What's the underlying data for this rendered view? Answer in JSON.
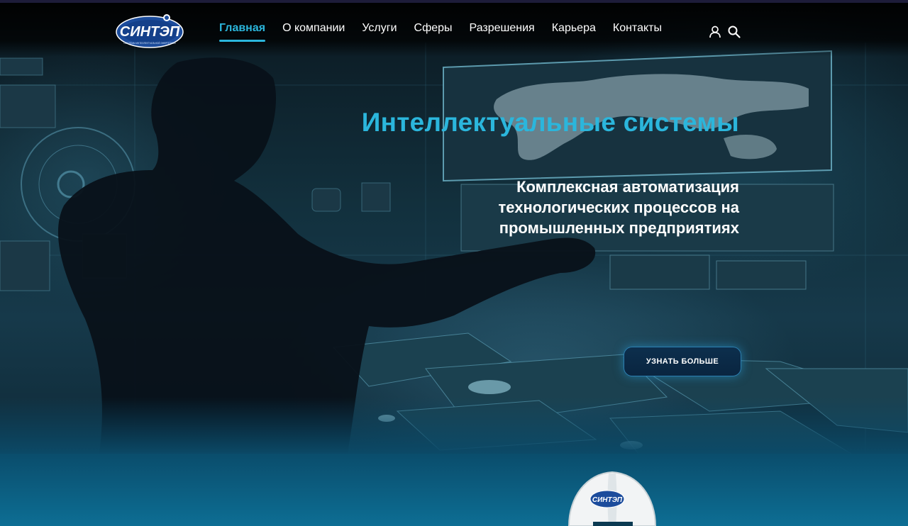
{
  "brand": {
    "logo_text": "СИНТЭП",
    "logo_tagline": "СИСТЕМЫ ИНТЕЛЛЕКТУАЛЬНОЙ ЭНЕРГЕТИКИ"
  },
  "nav": {
    "items": [
      {
        "label": "Главная",
        "active": true
      },
      {
        "label": "О компании",
        "active": false
      },
      {
        "label": "Услуги",
        "active": false
      },
      {
        "label": "Сферы",
        "active": false
      },
      {
        "label": "Разрешения",
        "active": false
      },
      {
        "label": "Карьера",
        "active": false
      },
      {
        "label": "Контакты",
        "active": false
      }
    ],
    "icons": [
      "user-icon",
      "search-icon"
    ]
  },
  "hero": {
    "title": "Интеллектуальные системы",
    "subtitle": "Комплексная автоматизация технологических процессов на промышленных предприятиях",
    "cta_label": "УЗНАТЬ БОЛЬШЕ"
  },
  "helmet": {
    "logo_text": "СИНТЭП"
  },
  "colors": {
    "accent": "#2bb6dc",
    "text": "#ffffff",
    "button_bg": "#0a2540",
    "lower_band": "#0d6e94"
  }
}
